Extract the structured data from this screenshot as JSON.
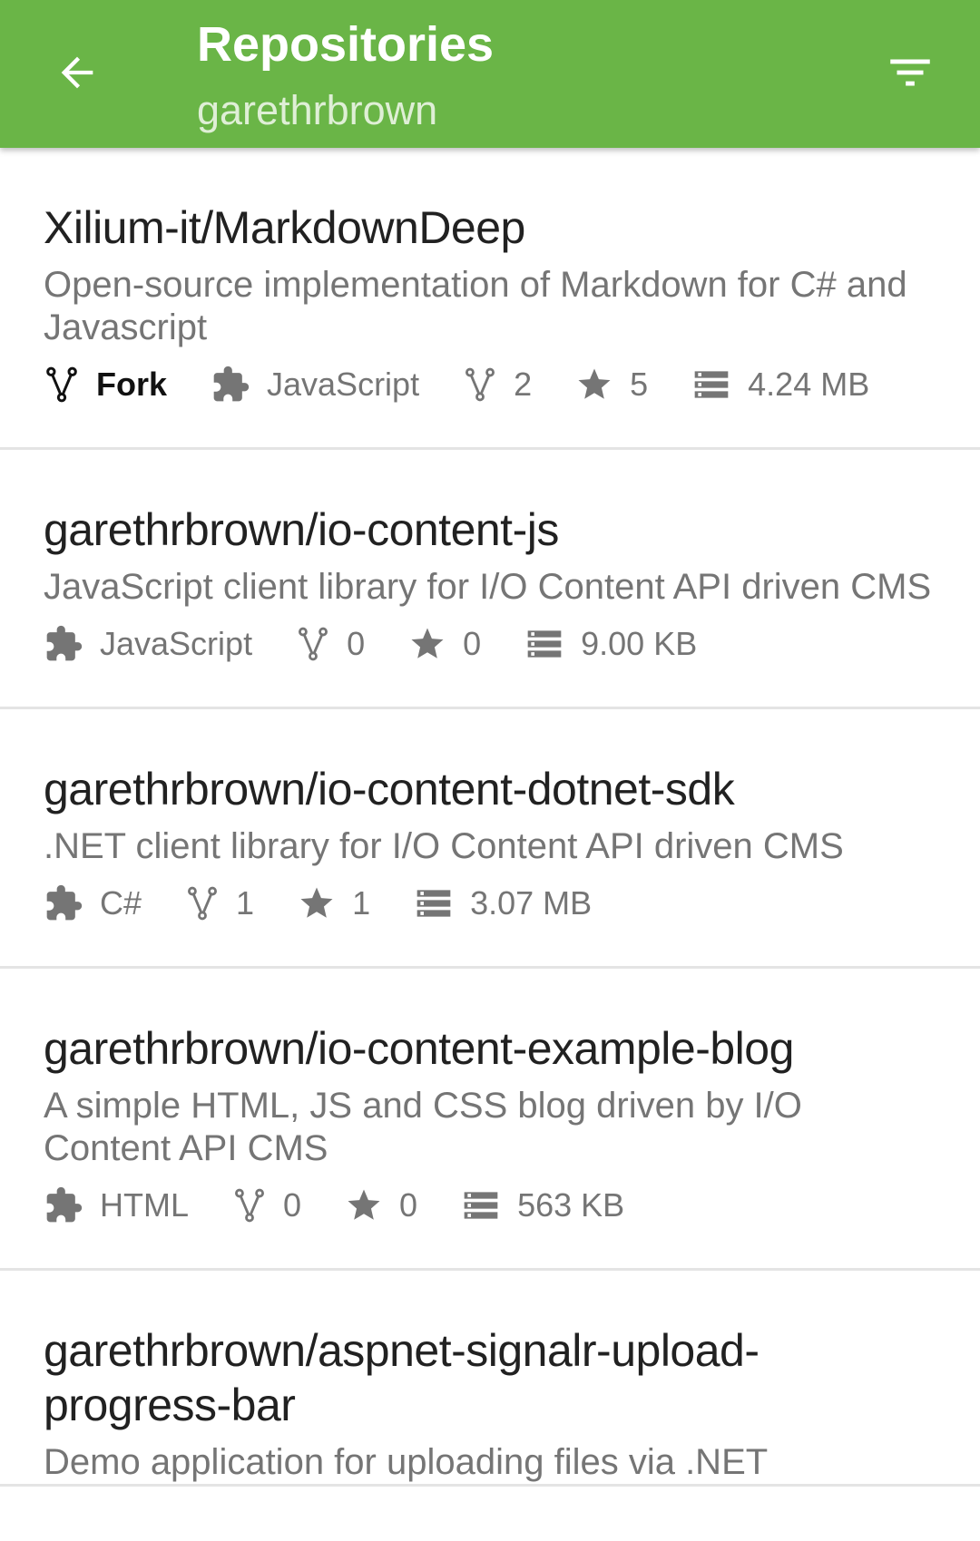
{
  "appbar": {
    "title": "Repositories",
    "subtitle": "garethrbrown",
    "background": "#6ab547",
    "back_icon": "arrow-left-icon",
    "filter_icon": "filter-list-icon"
  },
  "repos": [
    {
      "name": "Xilium-it/MarkdownDeep",
      "description": "Open-source implementation of Markdown for C# and Javascript",
      "fork_label": "Fork",
      "language": "JavaScript",
      "forks": "2",
      "stars": "5",
      "size": "4.24 MB"
    },
    {
      "name": "garethrbrown/io-content-js",
      "description": "JavaScript client library for I/O Content API driven CMS",
      "language": "JavaScript",
      "forks": "0",
      "stars": "0",
      "size": "9.00 KB"
    },
    {
      "name": "garethrbrown/io-content-dotnet-sdk",
      "description": ".NET client library for I/O Content API driven CMS",
      "language": "C#",
      "forks": "1",
      "stars": "1",
      "size": "3.07 MB"
    },
    {
      "name": "garethrbrown/io-content-example-blog",
      "description": "A simple HTML, JS and CSS blog driven by I/O Content API CMS",
      "language": "HTML",
      "forks": "0",
      "stars": "0",
      "size": "563 KB"
    },
    {
      "name": "garethrbrown/aspnet-signalr-upload-progress-bar",
      "description": "Demo application for uploading files via .NET"
    }
  ],
  "icons": {
    "fork": "fork-icon",
    "language": "puzzle-icon",
    "star": "star-icon",
    "size": "storage-icon"
  }
}
